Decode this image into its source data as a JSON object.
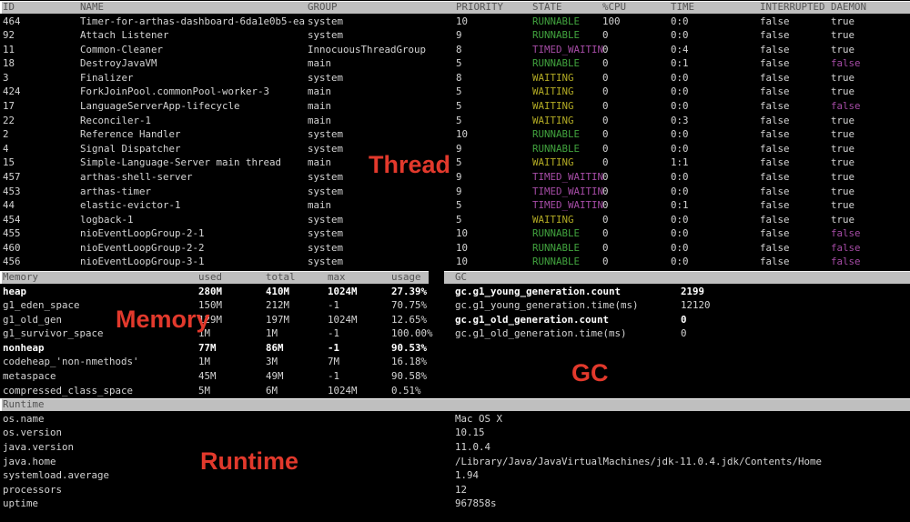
{
  "colors": {
    "background": "#000000",
    "text": "#d4d4d4",
    "bold_text": "#ffffff",
    "header_bg": "#bfbfbf",
    "header_text": "#545454",
    "green": "#41a33e",
    "yellow": "#b2aa24",
    "magenta": "#a64ca6",
    "annotation_red": "#e2392c"
  },
  "annotations": {
    "thread": "Thread",
    "memory": "Memory",
    "gc": "GC",
    "runtime": "Runtime"
  },
  "thread_table": {
    "headers": {
      "id": "ID",
      "name": "NAME",
      "group": "GROUP",
      "priority": "PRIORITY",
      "state": "STATE",
      "cpu": "%CPU",
      "time": "TIME",
      "interrupted": "INTERRUPTED",
      "daemon": "DAEMON"
    },
    "rows": [
      {
        "id": "464",
        "name": "Timer-for-arthas-dashboard-6da1e0b5-ea",
        "group": "system",
        "priority": "10",
        "state": "RUNNABLE",
        "cpu": "100",
        "time": "0:0",
        "interrupted": "false",
        "daemon": "true"
      },
      {
        "id": "92",
        "name": "Attach Listener",
        "group": "system",
        "priority": "9",
        "state": "RUNNABLE",
        "cpu": "0",
        "time": "0:0",
        "interrupted": "false",
        "daemon": "true"
      },
      {
        "id": "11",
        "name": "Common-Cleaner",
        "group": "InnocuousThreadGroup",
        "priority": "8",
        "state": "TIMED_WAITIN",
        "cpu": "0",
        "time": "0:4",
        "interrupted": "false",
        "daemon": "true"
      },
      {
        "id": "18",
        "name": "DestroyJavaVM",
        "group": "main",
        "priority": "5",
        "state": "RUNNABLE",
        "cpu": "0",
        "time": "0:1",
        "interrupted": "false",
        "daemon": "false"
      },
      {
        "id": "3",
        "name": "Finalizer",
        "group": "system",
        "priority": "8",
        "state": "WAITING",
        "cpu": "0",
        "time": "0:0",
        "interrupted": "false",
        "daemon": "true"
      },
      {
        "id": "424",
        "name": "ForkJoinPool.commonPool-worker-3",
        "group": "main",
        "priority": "5",
        "state": "WAITING",
        "cpu": "0",
        "time": "0:0",
        "interrupted": "false",
        "daemon": "true"
      },
      {
        "id": "17",
        "name": "LanguageServerApp-lifecycle",
        "group": "main",
        "priority": "5",
        "state": "WAITING",
        "cpu": "0",
        "time": "0:0",
        "interrupted": "false",
        "daemon": "false"
      },
      {
        "id": "22",
        "name": "Reconciler-1",
        "group": "main",
        "priority": "5",
        "state": "WAITING",
        "cpu": "0",
        "time": "0:3",
        "interrupted": "false",
        "daemon": "true"
      },
      {
        "id": "2",
        "name": "Reference Handler",
        "group": "system",
        "priority": "10",
        "state": "RUNNABLE",
        "cpu": "0",
        "time": "0:0",
        "interrupted": "false",
        "daemon": "true"
      },
      {
        "id": "4",
        "name": "Signal Dispatcher",
        "group": "system",
        "priority": "9",
        "state": "RUNNABLE",
        "cpu": "0",
        "time": "0:0",
        "interrupted": "false",
        "daemon": "true"
      },
      {
        "id": "15",
        "name": "Simple-Language-Server main thread",
        "group": "main",
        "priority": "5",
        "state": "WAITING",
        "cpu": "0",
        "time": "1:1",
        "interrupted": "false",
        "daemon": "true"
      },
      {
        "id": "457",
        "name": "arthas-shell-server",
        "group": "system",
        "priority": "9",
        "state": "TIMED_WAITIN",
        "cpu": "0",
        "time": "0:0",
        "interrupted": "false",
        "daemon": "true"
      },
      {
        "id": "453",
        "name": "arthas-timer",
        "group": "system",
        "priority": "9",
        "state": "TIMED_WAITIN",
        "cpu": "0",
        "time": "0:0",
        "interrupted": "false",
        "daemon": "true"
      },
      {
        "id": "44",
        "name": "elastic-evictor-1",
        "group": "main",
        "priority": "5",
        "state": "TIMED_WAITIN",
        "cpu": "0",
        "time": "0:1",
        "interrupted": "false",
        "daemon": "true"
      },
      {
        "id": "454",
        "name": "logback-1",
        "group": "system",
        "priority": "5",
        "state": "WAITING",
        "cpu": "0",
        "time": "0:0",
        "interrupted": "false",
        "daemon": "true"
      },
      {
        "id": "455",
        "name": "nioEventLoopGroup-2-1",
        "group": "system",
        "priority": "10",
        "state": "RUNNABLE",
        "cpu": "0",
        "time": "0:0",
        "interrupted": "false",
        "daemon": "false"
      },
      {
        "id": "460",
        "name": "nioEventLoopGroup-2-2",
        "group": "system",
        "priority": "10",
        "state": "RUNNABLE",
        "cpu": "0",
        "time": "0:0",
        "interrupted": "false",
        "daemon": "false"
      },
      {
        "id": "456",
        "name": "nioEventLoopGroup-3-1",
        "group": "system",
        "priority": "10",
        "state": "RUNNABLE",
        "cpu": "0",
        "time": "0:0",
        "interrupted": "false",
        "daemon": "false"
      }
    ]
  },
  "memory_table": {
    "headers": {
      "memory": "Memory",
      "used": "used",
      "total": "total",
      "max": "max",
      "usage": "usage"
    },
    "rows": [
      {
        "name": "heap",
        "used": "280M",
        "total": "410M",
        "max": "1024M",
        "usage": "27.39%",
        "bold": true
      },
      {
        "name": "g1_eden_space",
        "used": "150M",
        "total": "212M",
        "max": "-1",
        "usage": "70.75%",
        "bold": false
      },
      {
        "name": "g1_old_gen",
        "used": "129M",
        "total": "197M",
        "max": "1024M",
        "usage": "12.65%",
        "bold": false
      },
      {
        "name": "g1_survivor_space",
        "used": "1M",
        "total": "1M",
        "max": "-1",
        "usage": "100.00%",
        "bold": false
      },
      {
        "name": "nonheap",
        "used": "77M",
        "total": "86M",
        "max": "-1",
        "usage": "90.53%",
        "bold": true
      },
      {
        "name": "codeheap_'non-nmethods'",
        "used": "1M",
        "total": "3M",
        "max": "7M",
        "usage": "16.18%",
        "bold": false
      },
      {
        "name": "metaspace",
        "used": "45M",
        "total": "49M",
        "max": "-1",
        "usage": "90.58%",
        "bold": false
      },
      {
        "name": "compressed_class_space",
        "used": "5M",
        "total": "6M",
        "max": "1024M",
        "usage": "0.51%",
        "bold": false
      }
    ]
  },
  "gc_table": {
    "header": "GC",
    "rows": [
      {
        "key": "gc.g1_young_generation.count",
        "value": "2199",
        "bold": true
      },
      {
        "key": "gc.g1_young_generation.time(ms)",
        "value": "12120",
        "bold": false
      },
      {
        "key": "gc.g1_old_generation.count",
        "value": "0",
        "bold": true
      },
      {
        "key": "gc.g1_old_generation.time(ms)",
        "value": "0",
        "bold": false
      }
    ]
  },
  "runtime_table": {
    "header": "Runtime",
    "rows": [
      {
        "key": "os.name",
        "value": "Mac OS X"
      },
      {
        "key": "os.version",
        "value": "10.15"
      },
      {
        "key": "java.version",
        "value": "11.0.4"
      },
      {
        "key": "java.home",
        "value": "/Library/Java/JavaVirtualMachines/jdk-11.0.4.jdk/Contents/Home"
      },
      {
        "key": "systemload.average",
        "value": "1.94"
      },
      {
        "key": "processors",
        "value": "12"
      },
      {
        "key": "uptime",
        "value": "967858s"
      }
    ]
  }
}
